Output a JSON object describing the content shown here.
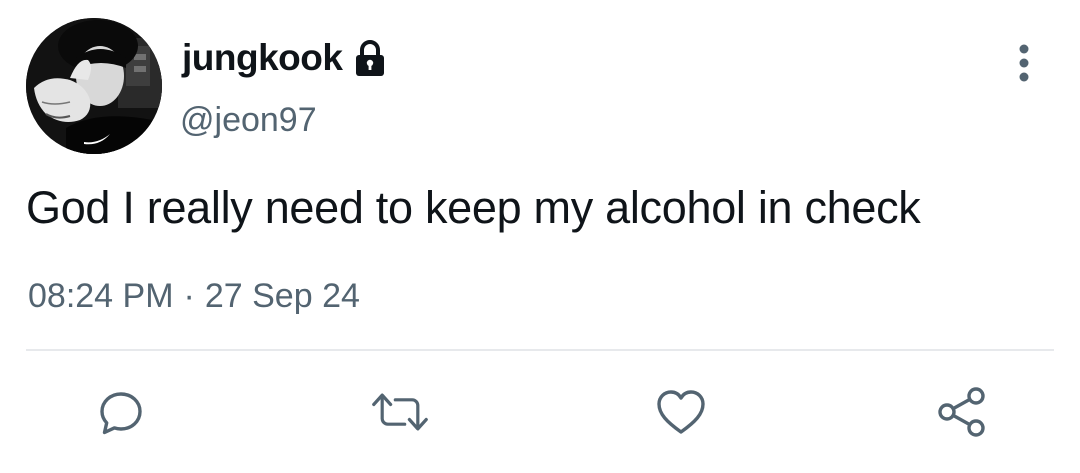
{
  "author": {
    "display_name": "jungkook",
    "username": "@jeon97",
    "avatar_icon": "avatar",
    "protected_icon": "lock-icon"
  },
  "tweet": {
    "text": "God I really need to keep my alcohol in check",
    "time": "08:24 PM",
    "separator": "·",
    "date": "27 Sep 24"
  },
  "actions": [
    {
      "name": "reply",
      "icon": "reply-icon"
    },
    {
      "name": "retweet",
      "icon": "retweet-icon"
    },
    {
      "name": "like",
      "icon": "heart-icon"
    },
    {
      "name": "share",
      "icon": "share-icon"
    }
  ],
  "colors": {
    "text_primary": "#0f1419",
    "text_secondary": "#536471",
    "divider": "#e7e9ec",
    "icon": "#536471"
  }
}
